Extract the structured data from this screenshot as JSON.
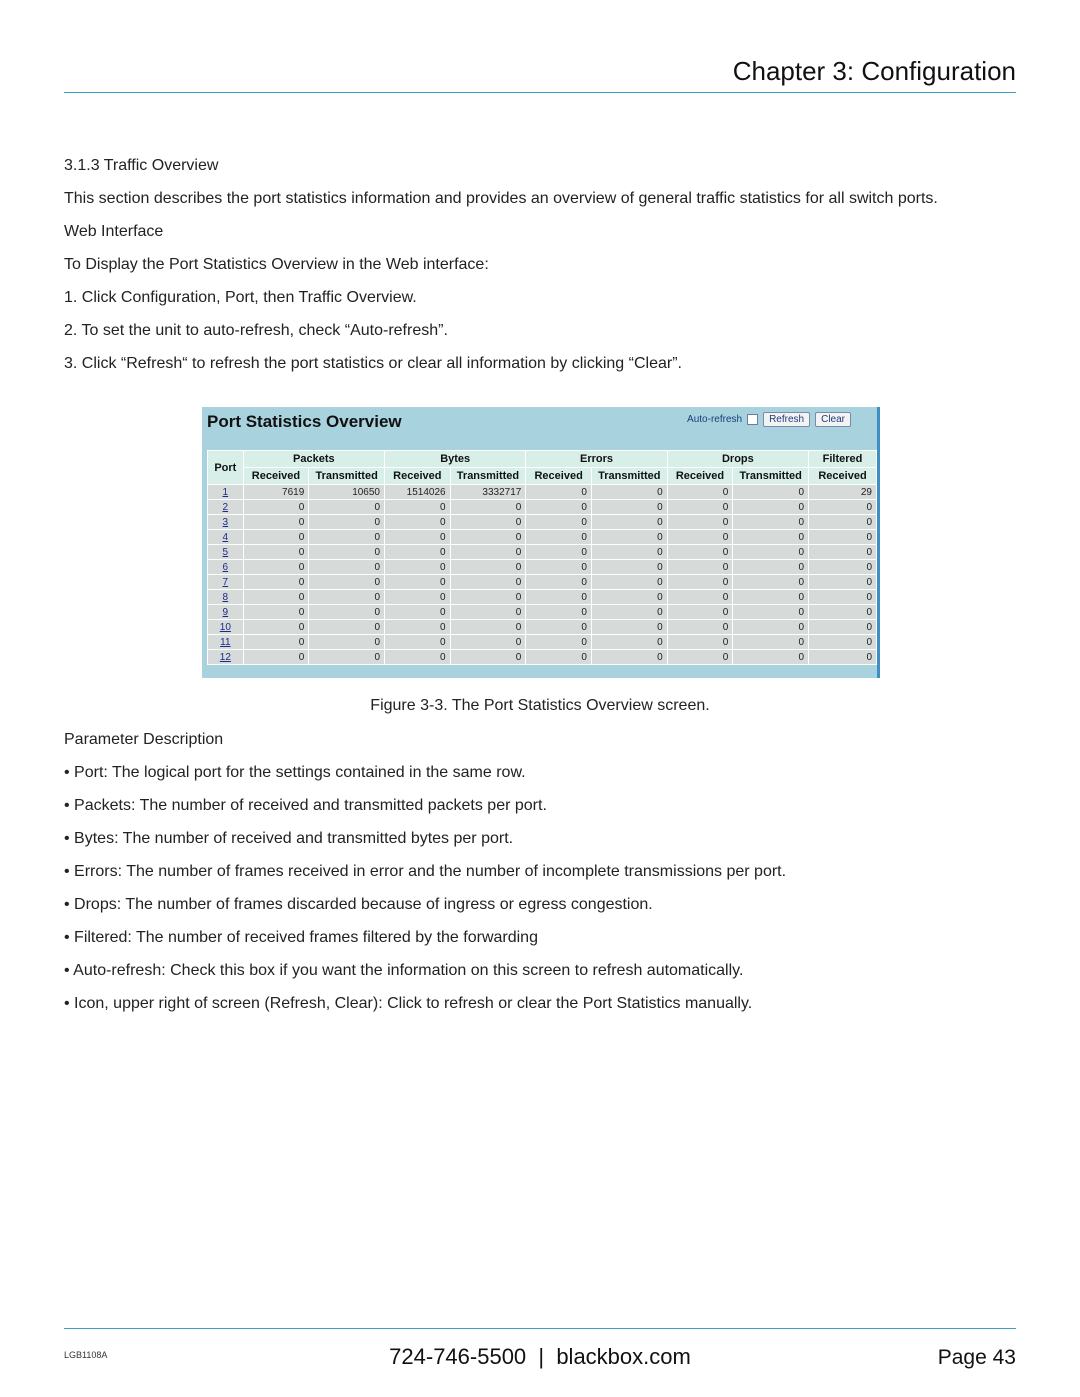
{
  "header": {
    "chapter": "Chapter 3: Configuration"
  },
  "section": {
    "title": "3.1.3 Traffic Overview",
    "intro": "This section describes the port statistics information and provides an overview of general traffic statistics for all switch ports.",
    "subheading": "Web Interface",
    "instruction": "To Display the Port Statistics Overview in the Web interface:",
    "steps": [
      "1. Click Configuration, Port, then Traffic Overview.",
      "2. To set the unit to auto-refresh, check “Auto-refresh”.",
      "3. Click “Refresh“ to refresh the port statistics or clear all information by clicking “Clear”."
    ]
  },
  "figure": {
    "title": "Port Statistics Overview",
    "auto_refresh_label": "Auto-refresh",
    "auto_refresh_checked": false,
    "refresh_label": "Refresh",
    "clear_label": "Clear",
    "group_headers": [
      "Port",
      "Packets",
      "Bytes",
      "Errors",
      "Drops",
      "Filtered"
    ],
    "sub_headers": [
      "Received",
      "Transmitted",
      "Received",
      "Transmitted",
      "Received",
      "Transmitted",
      "Received",
      "Transmitted",
      "Received"
    ],
    "rows": [
      [
        "1",
        "7619",
        "10650",
        "1514026",
        "3332717",
        "0",
        "0",
        "0",
        "0",
        "29"
      ],
      [
        "2",
        "0",
        "0",
        "0",
        "0",
        "0",
        "0",
        "0",
        "0",
        "0"
      ],
      [
        "3",
        "0",
        "0",
        "0",
        "0",
        "0",
        "0",
        "0",
        "0",
        "0"
      ],
      [
        "4",
        "0",
        "0",
        "0",
        "0",
        "0",
        "0",
        "0",
        "0",
        "0"
      ],
      [
        "5",
        "0",
        "0",
        "0",
        "0",
        "0",
        "0",
        "0",
        "0",
        "0"
      ],
      [
        "6",
        "0",
        "0",
        "0",
        "0",
        "0",
        "0",
        "0",
        "0",
        "0"
      ],
      [
        "7",
        "0",
        "0",
        "0",
        "0",
        "0",
        "0",
        "0",
        "0",
        "0"
      ],
      [
        "8",
        "0",
        "0",
        "0",
        "0",
        "0",
        "0",
        "0",
        "0",
        "0"
      ],
      [
        "9",
        "0",
        "0",
        "0",
        "0",
        "0",
        "0",
        "0",
        "0",
        "0"
      ],
      [
        "10",
        "0",
        "0",
        "0",
        "0",
        "0",
        "0",
        "0",
        "0",
        "0"
      ],
      [
        "11",
        "0",
        "0",
        "0",
        "0",
        "0",
        "0",
        "0",
        "0",
        "0"
      ],
      [
        "12",
        "0",
        "0",
        "0",
        "0",
        "0",
        "0",
        "0",
        "0",
        "0"
      ]
    ],
    "caption": "Figure 3-3. The Port Statistics Overview screen."
  },
  "params": {
    "heading": "Parameter Description",
    "items": [
      {
        "term": "Port",
        "desc": ": The logical port for the settings contained in the same row."
      },
      {
        "term": "Packets",
        "desc": ": The number of received and transmitted packets per port."
      },
      {
        "term": "Bytes",
        "desc": ": The number of received and transmitted bytes per port."
      },
      {
        "term": "Errors",
        "desc": ": The number of frames received in error and the number of incomplete transmissions per port."
      },
      {
        "term": "Drops",
        "desc": ": The number of frames discarded because of ingress or egress congestion."
      },
      {
        "term": "Filtered",
        "desc": ": The number of received frames filtered by the forwarding"
      },
      {
        "term": "Auto-refresh",
        "desc": ": Check this box if you want the information on this screen to refresh automatically."
      },
      {
        "term": "Icon, upper right of screen (Refresh, Clear)",
        "desc": ": Click to refresh or clear the Port Statistics manually."
      }
    ]
  },
  "footer": {
    "doc_id": "LGB1108A",
    "contact": "724-746-5500  |  blackbox.com",
    "page": "Page 43"
  }
}
